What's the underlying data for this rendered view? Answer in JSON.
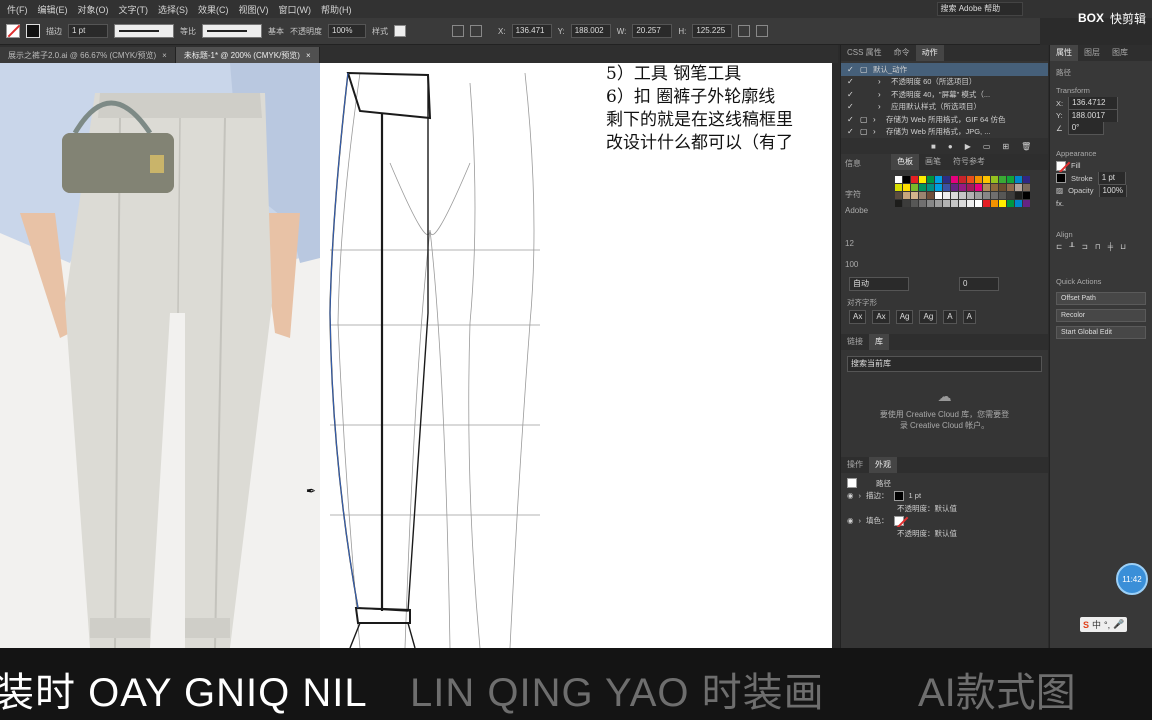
{
  "menu": {
    "items": [
      "件(F)",
      "编辑(E)",
      "对象(O)",
      "文字(T)",
      "选择(S)",
      "效果(C)",
      "视图(V)",
      "窗口(W)",
      "帮助(H)"
    ],
    "search_placeholder": "搜索 Adobe 帮助",
    "brand": "快剪辑"
  },
  "control": {
    "selection_label": "描边",
    "stroke_weight": "1 pt",
    "profile_label": "等比",
    "brush_label": "基本",
    "opacity_label": "不透明度",
    "opacity_value": "100%",
    "style_label": "样式",
    "x_value": "136.471",
    "y_value": "188.002",
    "w_value": "20.257",
    "h_value": "125.225"
  },
  "tabs": [
    {
      "label": "展示之裤子2.0.ai @ 66.67% (CMYK/预览)",
      "active": false
    },
    {
      "label": "未标题-1* @ 200% (CMYK/预览)",
      "active": true
    }
  ],
  "notes": {
    "line1": "5）工具 钢笔工具",
    "line2": "6）扣  圈裤子外轮廓线",
    "line3": "剩下的就是在这线稿框里",
    "line4": "改设计什么都可以（有了"
  },
  "actions_panel": {
    "tabs": [
      "CSS 属性",
      "命令",
      "动作"
    ],
    "items": [
      {
        "label": "默认_动作",
        "selected": true
      },
      {
        "label": "不透明度 60（所选项目）",
        "selected": false
      },
      {
        "label": "不透明度 40，\"屏幕\" 模式（...",
        "selected": false
      },
      {
        "label": "应用默认样式（所选项目）",
        "selected": false
      },
      {
        "label": "存储为 Web 所用格式，GIF 64 仿色",
        "selected": false
      },
      {
        "label": "存储为 Web 所用格式，JPG, ...",
        "selected": false
      }
    ]
  },
  "swatches_panel": {
    "tabs": [
      "色板",
      "画笔",
      "符号参考"
    ]
  },
  "char_panel": {
    "tabs": [
      "字符",
      "段"
    ],
    "font": "Adobe",
    "size": "12",
    "leading": "100",
    "tracking": "自动",
    "kerning": "0",
    "opentype_label": "对齐字形"
  },
  "library_panel": {
    "tabs": [
      "链接",
      "库"
    ],
    "search_placeholder": "搜索当前库",
    "cc_message_1": "要使用 Creative Cloud 库，您需要登",
    "cc_message_2": "录 Creative Cloud 帐户。"
  },
  "appearance_panel": {
    "tabs": [
      "操作",
      "外观"
    ],
    "title": "路径",
    "stroke_label": "描边：",
    "stroke_value": "1 pt",
    "opacity_row": "不透明度：默认值",
    "fill_label": "填色：",
    "opacity_row2": "不透明度：默认值"
  },
  "properties_panel": {
    "tabs": [
      "属性",
      "图层",
      "图库"
    ],
    "kind": "路径",
    "transform_label": "Transform",
    "x": "136.4712",
    "y": "188.0017",
    "angle": "0°",
    "appearance_label": "Appearance",
    "fill_label": "Fill",
    "stroke_label": "Stroke",
    "stroke_weight": "1 pt",
    "opacity_label": "Opacity",
    "opacity_value": "100%",
    "align_label": "Align",
    "quick_actions_label": "Quick Actions",
    "btn_offset": "Offset Path",
    "btn_recolor": "Recolor",
    "btn_global": "Start Global Edit"
  },
  "caption": {
    "left": "装时 OAY  GNIQ  NIL",
    "middle": "LIN QING YAO 时装画",
    "right": "AI款式图"
  },
  "status": {
    "clock": "11:42",
    "ime_char": "中"
  }
}
